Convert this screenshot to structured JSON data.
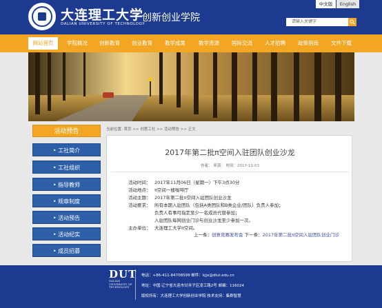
{
  "header": {
    "uni_name_cn": "大连理工大学",
    "uni_name_en": "DALIAN UNIVERSITY OF TECHNOLOGY",
    "site_title": "创新创业学院",
    "lang_cn": "中文版",
    "lang_en": "English",
    "search_placeholder": "请输入关键字",
    "search_icon": "magnifier-icon",
    "brand_blue": "#1c3a8f",
    "accent_orange": "#f3a623"
  },
  "nav": {
    "items": [
      "网站首页",
      "学院概况",
      "创新教育",
      "创业教育",
      "教学成果",
      "教学资源",
      "国际交流",
      "人才招聘",
      "政策指南",
      "文件下载"
    ]
  },
  "sidebar": {
    "heading": "活动预告",
    "items": [
      "工社简介",
      "工社组织",
      "指导教师",
      "规章制度",
      "活动预告",
      "活动纪实",
      "成员招募"
    ],
    "bullet": "•"
  },
  "breadcrumb": "当前位置: 首页 >> 创意工社 >> 活动预告 >> 正文",
  "article": {
    "title": "2017年第二批π空间入驻团队创业沙龙",
    "meta": "作者：   来源：   时间：2017-11-03",
    "rows": [
      {
        "label": "活动时间：",
        "value": "2017年11月06日（星期一）下午3点30分"
      },
      {
        "label": "活动地点：",
        "value": "π空间一楼咖啡厅"
      },
      {
        "label": "活动主题：",
        "value": "2017年第二批π空间入驻团队创业沙龙"
      },
      {
        "label": "活动要求：",
        "value": "所有本期入驻团队（包括A类团队和B类企业/团队）负责人参加；"
      },
      {
        "label": "",
        "value": "负责人有事可指定至少一名成员代替参加；"
      },
      {
        "label": "",
        "value": "入驻团队每网创业门诊与创业沙龙至少参加一次。"
      },
      {
        "label": "主办单位：",
        "value": "大连理工大学π空间。"
      }
    ],
    "prev_label": "上一条：",
    "prev_link": "创意竞赛发布会",
    "next_label": "下一条：",
    "next_link": "2017年第二批π空间入驻团队创业门诊"
  },
  "footer": {
    "logo_text": "DUT",
    "logo_sub": [
      "DALIAN",
      "UNIVERSITY OF",
      "TECHNOLOGY"
    ],
    "phone_line": "电话：+86-411-84708599    邮件：kjjx@dlut.edu.cn",
    "address_line": "地址：中国·辽宁省大连市甘井子区凌工路2号    邮编：116024",
    "copyright_line": "版权所有：大连理工大学创新创业学院    技术支持：集群智慧"
  }
}
